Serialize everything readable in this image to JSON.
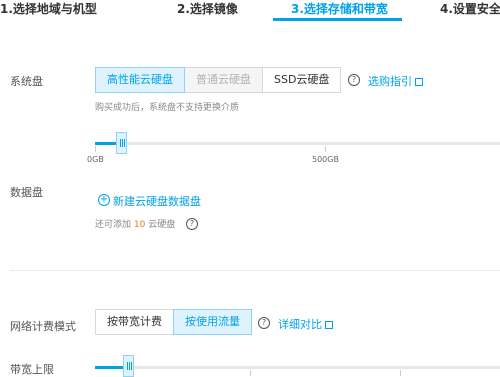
{
  "steps": [
    {
      "label": "1.选择地域与机型"
    },
    {
      "label": "2.选择镜像"
    },
    {
      "label": "3.选择存储和带宽"
    },
    {
      "label": "4.设置安全"
    }
  ],
  "system_disk": {
    "label": "系统盘",
    "options": [
      "高性能云硬盘",
      "普通云硬盘",
      "SSD云硬盘"
    ],
    "selected": "高性能云硬盘",
    "disabled": "普通云硬盘",
    "help_icon": "question-circle-icon",
    "link": "选购指引",
    "note": "购买成功后，系统盘不支持更换介质",
    "slider": {
      "min_label": "0GB",
      "mid_label": "500GB"
    }
  },
  "data_disk": {
    "label": "数据盘",
    "add_link": "新建云硬盘数据盘",
    "note_prefix": "还可添加",
    "note_count": "10",
    "note_suffix": "云硬盘"
  },
  "network": {
    "label": "网络计费模式",
    "options": [
      "按带宽计费",
      "按使用流量"
    ],
    "selected": "按使用流量",
    "link": "详细对比"
  },
  "bandwidth": {
    "label": "带宽上限"
  },
  "colors": {
    "accent": "#00a2ea",
    "count": "#f27c00"
  }
}
